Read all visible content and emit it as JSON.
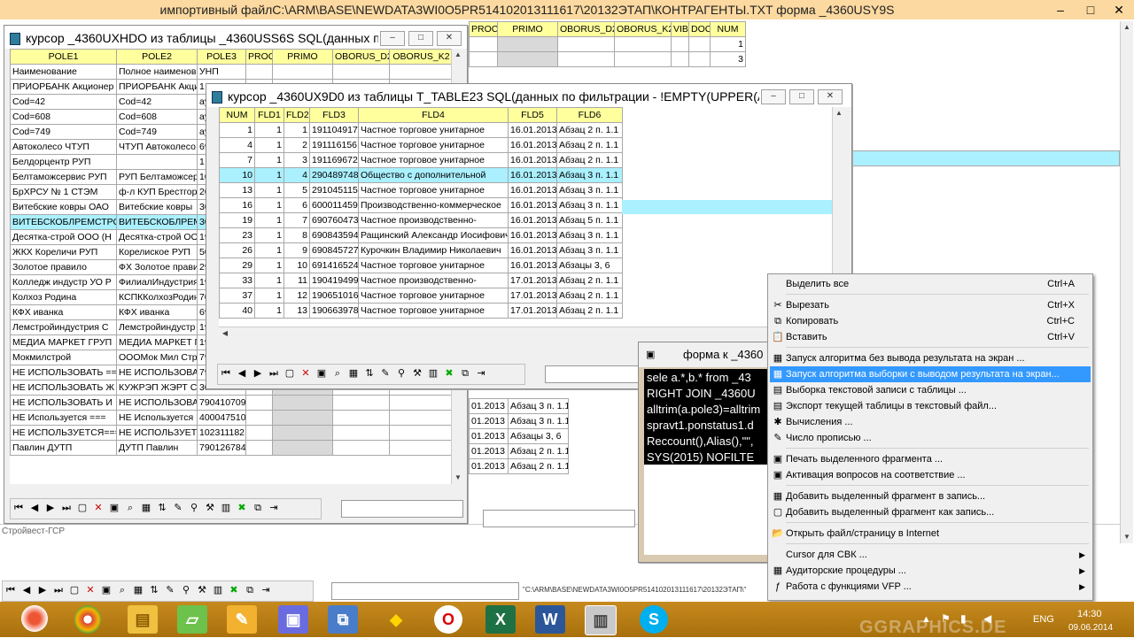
{
  "main_title": "импортивный файлC:\\ARM\\BASE\\NEWDATA3WI0O5PR514102013111617\\20132ЭТАП\\КОНТРАГЕНТЫ.TXT форма _4360USY9S",
  "win1": {
    "title": "курсор _4360UXHDO из таблицы _4360USS6S SQL(данных п...",
    "headers": [
      "POLE1",
      "POLE2",
      "POLE3",
      "PROC",
      "PRIMO",
      "OBORUS_D2",
      "OBORUS_K2"
    ],
    "rows": [
      [
        "Наименование",
        "Полное наименов",
        "УНП"
      ],
      [
        "ПРИОРБАНК Акционер",
        "ПРИОРБАНК Акци",
        "1"
      ],
      [
        "Cod=42",
        "Cod=42",
        "ay"
      ],
      [
        "Cod=608",
        "Cod=608",
        "ay"
      ],
      [
        "Cod=749",
        "Cod=749",
        "ay"
      ],
      [
        "Автоколесо ЧТУП",
        "ЧТУП Автоколесо",
        "69"
      ],
      [
        "Белдорцентр РУП",
        "",
        "1"
      ],
      [
        "Белтаможсервис РУП",
        "РУП Белтаможсер",
        "10"
      ],
      [
        "БрХРСУ № 1 СТЭМ",
        "ф-л КУП Брестгор",
        "20"
      ],
      [
        "Витебские ковры ОАО",
        "Витебские ковры",
        "30"
      ],
      [
        "ВИТЕБСКОБЛРЕМСТРО",
        "ВИТЕБСКОБЛРЕМ",
        "30"
      ],
      [
        "Десятка-строй ООО (Н",
        "Десятка-строй ОО",
        "19"
      ],
      [
        "ЖКХ Кореличи РУП",
        "Корелиское РУП",
        "50"
      ],
      [
        "Золотое правило",
        "ФХ Золотое прави",
        "29"
      ],
      [
        "Колледж индустр УО Р",
        "ФилиалИндустрия",
        "19"
      ],
      [
        "Колхоз Родина",
        "КСПККолхозРодин",
        "70"
      ],
      [
        "КФХ иванка",
        "КФХ иванка",
        "69"
      ],
      [
        "Лемстройиндустрия С",
        "Лемстройиндустр",
        "19"
      ],
      [
        "МЕДИА МАРКЕТ ГРУП",
        "МЕДИА МАРКЕТ Г",
        "19"
      ],
      [
        "Мокмилстрой",
        "ОООМок Мил Стро",
        "79"
      ],
      [
        "НЕ ИСПОЛЬЗОВАТЬ ==",
        "НЕ ИСПОЛЬЗОВАТ",
        "79"
      ],
      [
        "НЕ ИСПОЛЬЗОВАТЬ Ж",
        "КУЖРЭП ЖЭРТ С",
        "30"
      ],
      [
        "НЕ ИСПОЛЬЗОВАТЬ И",
        "НЕ ИСПОЛЬЗОВАТ",
        "790410709"
      ],
      [
        "НЕ Используется ===",
        "НЕ Используется",
        "400047510"
      ],
      [
        "НЕ ИСПОЛЬЗУЕТСЯ===",
        "НЕ ИСПОЛЬЗУЕТС",
        "102311182"
      ],
      [
        "Павлин ДУТП",
        "ДУТП Павлин",
        "790126784"
      ]
    ]
  },
  "win2": {
    "title": "курсор _4360UX9D0 из таблицы T_TABLE23 SQL(данных по фильтрации - !EMPTY(UPPER(AL...",
    "headers": [
      "NUM",
      "FLD1",
      "FLD2",
      "FLD3",
      "FLD4",
      "FLD5",
      "FLD6"
    ],
    "rows": [
      [
        "1",
        "1",
        "1",
        "191104917",
        "Частное торговое унитарное",
        "16.01.2013",
        "Абзац 2 п. 1.1"
      ],
      [
        "4",
        "1",
        "2",
        "191116156",
        "Частное торговое унитарное",
        "16.01.2013",
        "Абзац 2 п. 1.1"
      ],
      [
        "7",
        "1",
        "3",
        "191169672",
        "Частное торговое унитарное",
        "16.01.2013",
        "Абзац 2 п. 1.1"
      ],
      [
        "10",
        "1",
        "4",
        "290489748",
        "Общество с дополнительной",
        "16.01.2013",
        "Абзац 3 п. 1.1"
      ],
      [
        "13",
        "1",
        "5",
        "291045115",
        "Частное торговое унитарное",
        "16.01.2013",
        "Абзац 3 п. 1.1"
      ],
      [
        "16",
        "1",
        "6",
        "600011459",
        "Производственно-коммерческое",
        "16.01.2013",
        "Абзац 3 п. 1.1"
      ],
      [
        "19",
        "1",
        "7",
        "690760473",
        "Частное производственно-",
        "16.01.2013",
        "Абзац 5 п. 1.1"
      ],
      [
        "23",
        "1",
        "8",
        "690843594",
        "Ращинский Александр Иосифович",
        "16.01.2013",
        "Абзац 3 п. 1.1"
      ],
      [
        "26",
        "1",
        "9",
        "690845727",
        "Курочкин Владимир Николаевич",
        "16.01.2013",
        "Абзац 3 п. 1.1"
      ],
      [
        "29",
        "1",
        "10",
        "691416524",
        "Частное торговое унитарное",
        "16.01.2013",
        "Абзацы 3, 6"
      ],
      [
        "33",
        "1",
        "11",
        "190419499",
        "Частное производственно-",
        "17.01.2013",
        "Абзац 2 п. 1.1"
      ],
      [
        "37",
        "1",
        "12",
        "190651016",
        "Частное торговое унитарное",
        "17.01.2013",
        "Абзац 2 п. 1.1"
      ],
      [
        "40",
        "1",
        "13",
        "190663978",
        "Частное торговое унитарное",
        "17.01.2013",
        "Абзац 2 п. 1.1"
      ]
    ]
  },
  "bg": {
    "headers": [
      "PROC",
      "PRIMO",
      "OBORUS_D2",
      "OBORUS_K2",
      "VIB",
      "DOC",
      "NUM"
    ],
    "num1": "1",
    "num2": "3",
    "bottom_rows": [
      [
        "01.2013",
        "Абзац 3 п. 1.1"
      ],
      [
        "01.2013",
        "Абзац 3 п. 1.1"
      ],
      [
        "01.2013",
        "Абзацы 3, 6"
      ],
      [
        "01.2013",
        "Абзац 2 п. 1.1"
      ],
      [
        "01.2013",
        "Абзац 2 п. 1.1"
      ]
    ],
    "under_row": "Стройвест-ГСР",
    "path_text": "\"C:\\ARM\\BASE\\NEWDATA3WI0O5PR514102013111617\\20132ЭТАП\\\""
  },
  "form": {
    "title": "форма к _4360",
    "lines": [
      "sele a.*,b.* from _43",
      "RIGHT JOIN _4360U",
      "alltrim(a.pole3)=alltrim",
      "spravt1.ponstatus1.d",
      "Reccount(),Alias(),\"\",",
      "SYS(2015) NOFILTE"
    ]
  },
  "menu": {
    "items": [
      {
        "label": "Выделить все",
        "sc": "Ctrl+A"
      },
      {
        "label": "Вырезать",
        "sc": "Ctrl+X",
        "icon": "✂"
      },
      {
        "label": "Копировать",
        "sc": "Ctrl+C",
        "icon": "⧉"
      },
      {
        "label": "Вставить",
        "sc": "Ctrl+V",
        "icon": "📋"
      },
      {
        "label": "Запуск алгоритма без вывода результата на экран ...",
        "icon": "▦"
      },
      {
        "label": "Запуск алгоритма выборки с выводом результата на экран...",
        "icon": "▦"
      },
      {
        "label": "Выборка текстовой записи с таблицы ...",
        "icon": "▤"
      },
      {
        "label": "Экспорт текущей таблицы в текстовый файл...",
        "icon": "▤"
      },
      {
        "label": "Вычисления ...",
        "icon": "✱"
      },
      {
        "label": "Число прописью ...",
        "icon": "✎"
      },
      {
        "label": "Печать выделенного фрагмента ...",
        "icon": "▣"
      },
      {
        "label": "Активация вопросов на соответствие ...",
        "icon": "▣"
      },
      {
        "label": "Добавить выделенный фрагмент в запись...",
        "icon": "▦"
      },
      {
        "label": "Добавить выделенный фрагмент как запись...",
        "icon": "▢"
      },
      {
        "label": "Открыть файл/страницу в Internet",
        "icon": "📂"
      },
      {
        "label": "Cursor для СВК ...",
        "sub": "▶"
      },
      {
        "label": "Аудиторские процедуры ...",
        "icon": "▦",
        "sub": "▶"
      },
      {
        "label": "Работа с функциями VFP ...",
        "icon": "ƒ",
        "sub": "▶"
      }
    ]
  },
  "tray": {
    "lang": "ENG",
    "time": "14:30",
    "date": "09.06.2014",
    "watermark": "GGRAPHICS.DE"
  }
}
